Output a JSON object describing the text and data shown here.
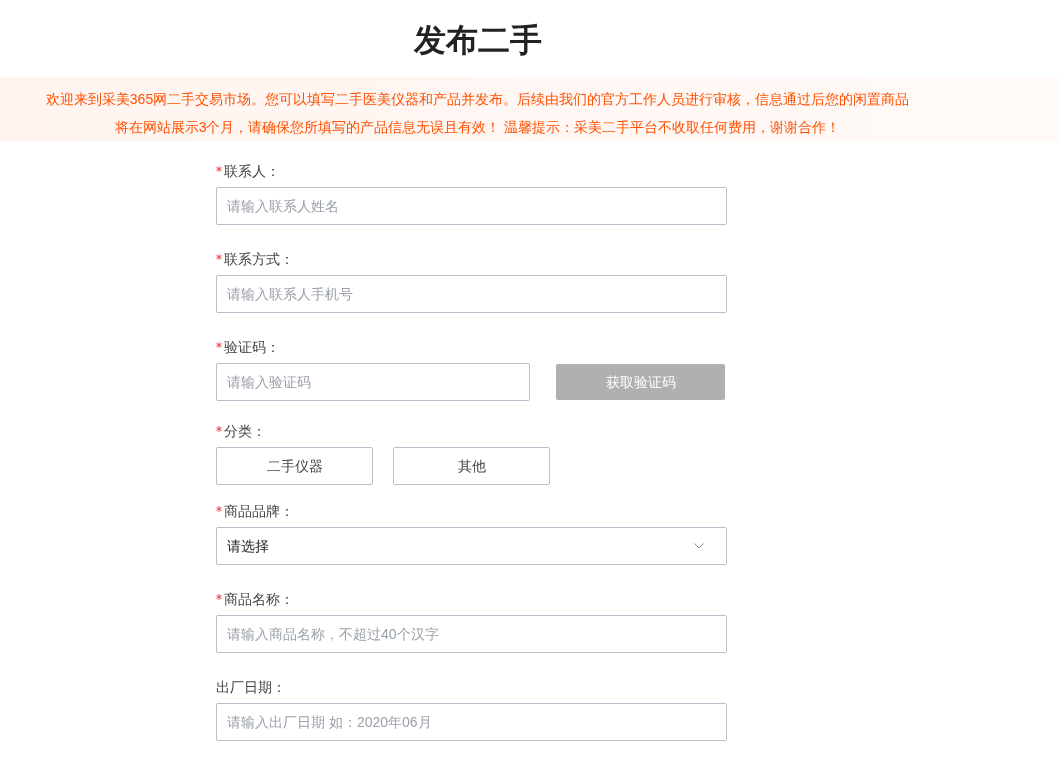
{
  "title": "发布二手",
  "notice": [
    "欢迎来到采美365网二手交易市场。您可以填写二手医美仪器和产品并发布。后续由我们的官方工作人员进行审核，信息通过后您的闲置商品",
    "将在网站展示3个月，请确保您所填写的产品信息无误且有效！ 温馨提示：采美二手平台不收取任何费用，谢谢合作！"
  ],
  "fields": [
    {
      "kind": "text",
      "label": "联系人：",
      "required": true,
      "placeholder": "请输入联系人姓名"
    },
    {
      "kind": "text",
      "label": "联系方式：",
      "required": true,
      "placeholder": "请输入联系人手机号"
    },
    {
      "kind": "code",
      "label": "验证码：",
      "required": true,
      "placeholder": "请输入验证码",
      "button": {
        "label": "获取验证码",
        "disabled": true
      }
    },
    {
      "kind": "choice",
      "label": "分类：",
      "required": true,
      "options": [
        {
          "label": "二手仪器",
          "selected": false
        },
        {
          "label": "其他",
          "selected": false
        }
      ]
    },
    {
      "kind": "select",
      "label": "商品品牌：",
      "required": true,
      "value": "请选择"
    },
    {
      "kind": "text",
      "label": "商品名称：",
      "required": true,
      "placeholder": "请输入商品名称，不超过40个汉字"
    },
    {
      "kind": "text",
      "label": "出厂日期：",
      "required": false,
      "placeholder": "请输入出厂日期 如：2020年06月"
    }
  ]
}
